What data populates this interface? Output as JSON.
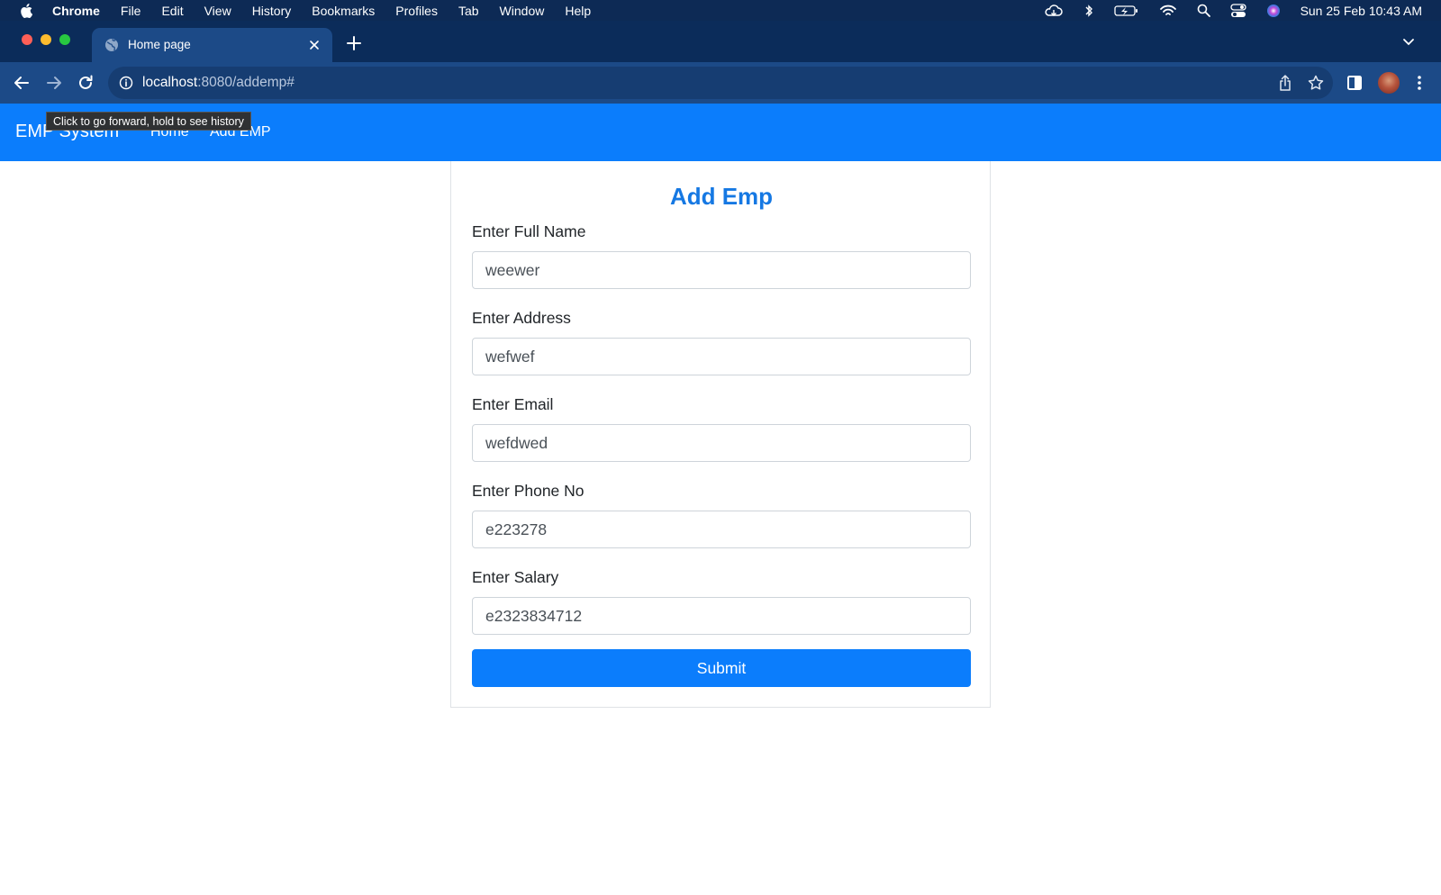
{
  "menubar": {
    "app_name": "Chrome",
    "items": [
      "File",
      "Edit",
      "View",
      "History",
      "Bookmarks",
      "Profiles",
      "Tab",
      "Window",
      "Help"
    ],
    "clock": "Sun 25 Feb  10:43 AM"
  },
  "browser": {
    "tab_title": "Home page",
    "url_host": "localhost",
    "url_path": ":8080/addemp#",
    "tooltip": "Click to go forward, hold to see history"
  },
  "navbar": {
    "brand": "EMP System",
    "links": [
      "Home",
      "Add EMP"
    ]
  },
  "form": {
    "title": "Add Emp",
    "fields": [
      {
        "label": "Enter Full Name",
        "value": "weewer"
      },
      {
        "label": "Enter Address",
        "value": "wefwef"
      },
      {
        "label": "Enter Email",
        "value": "wefdwed"
      },
      {
        "label": "Enter Phone No",
        "value": "e223278"
      },
      {
        "label": "Enter Salary",
        "value": "e2323834712"
      }
    ],
    "submit_label": "Submit"
  },
  "colors": {
    "primary": "#0b7dfc",
    "heading": "#1578e3",
    "browser_frame": "#0b2c5a",
    "menubar": "#0d2a55"
  }
}
